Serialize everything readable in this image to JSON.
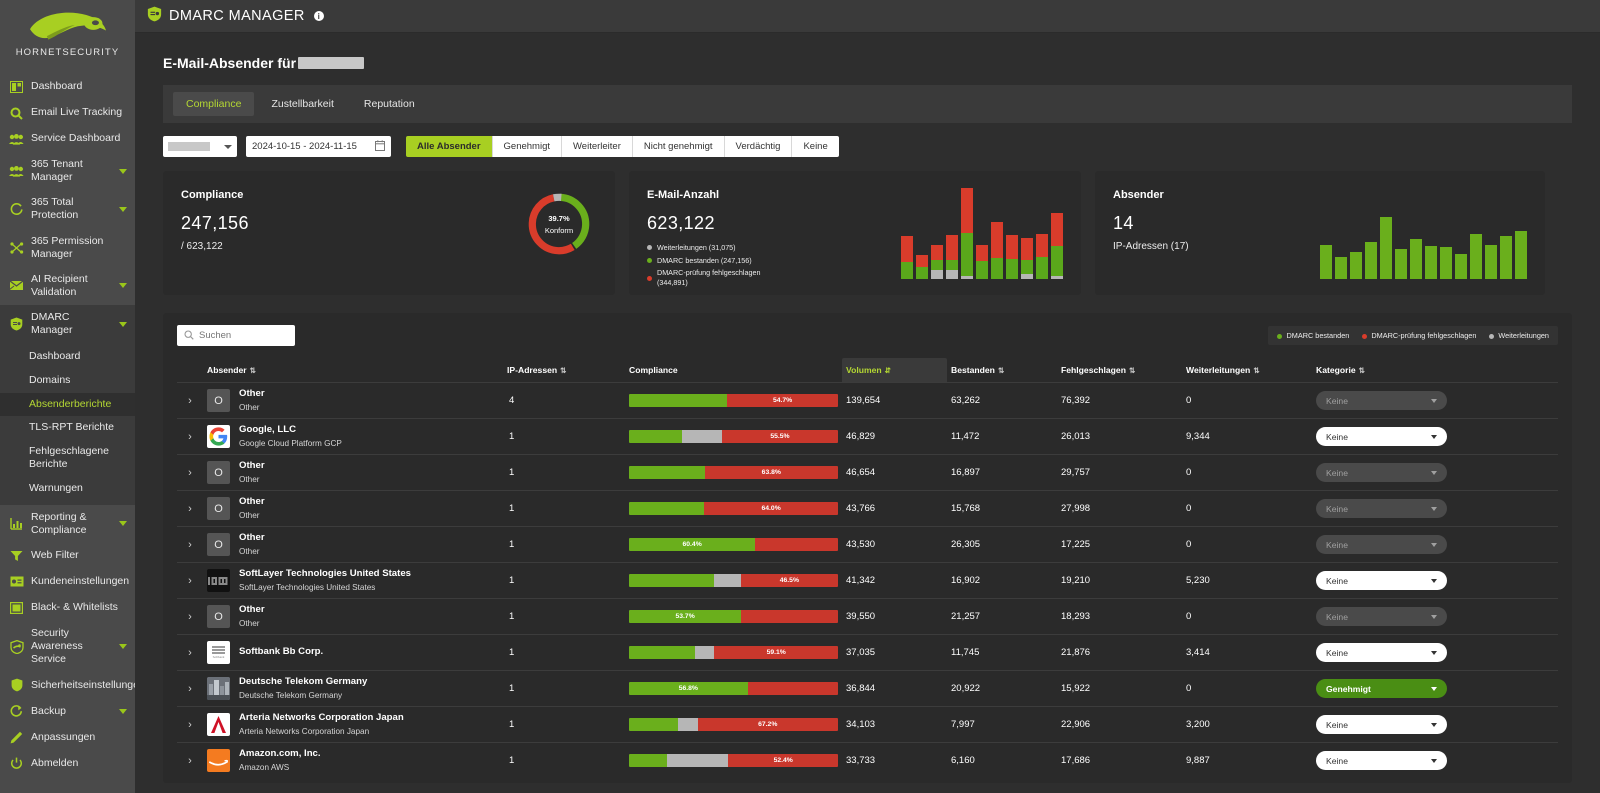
{
  "sidebar": {
    "brand": "HORNETSECURITY",
    "items": [
      {
        "label": "Dashboard",
        "icon": "dashboard-icon",
        "caret": false
      },
      {
        "label": "Email Live Tracking",
        "icon": "search-icon",
        "caret": false
      },
      {
        "label": "Service Dashboard",
        "icon": "people-icon",
        "caret": false
      },
      {
        "label": "365 Tenant Manager",
        "icon": "people-icon",
        "caret": true
      },
      {
        "label": "365 Total Protection",
        "icon": "circle-icon",
        "caret": true
      },
      {
        "label": "365 Permission Manager",
        "icon": "nodes-icon",
        "caret": false
      },
      {
        "label": "AI Recipient Validation",
        "icon": "envelope-check-icon",
        "caret": true
      },
      {
        "label": "DMARC Manager",
        "icon": "shield-icon",
        "caret": true,
        "active": true
      },
      {
        "label": "Reporting & Compliance",
        "icon": "chart-icon",
        "caret": true
      },
      {
        "label": "Web Filter",
        "icon": "filter-icon",
        "caret": false
      },
      {
        "label": "Kundeneinstellungen",
        "icon": "card-icon",
        "caret": true
      },
      {
        "label": "Black- & Whitelists",
        "icon": "list-icon",
        "caret": false
      },
      {
        "label": "Security Awareness Service",
        "icon": "shield-user-icon",
        "caret": true
      },
      {
        "label": "Sicherheitseinstellungen",
        "icon": "shield-lock-icon",
        "caret": true
      },
      {
        "label": "Backup",
        "icon": "refresh-icon",
        "caret": true
      },
      {
        "label": "Anpassungen",
        "icon": "pencil-icon",
        "caret": false
      },
      {
        "label": "Abmelden",
        "icon": "power-icon",
        "caret": false
      }
    ],
    "subnav": [
      {
        "label": "Dashboard",
        "selected": false
      },
      {
        "label": "Domains",
        "selected": false
      },
      {
        "label": "Absenderberichte",
        "selected": true
      },
      {
        "label": "TLS-RPT Berichte",
        "selected": false
      },
      {
        "label": "Fehlgeschlagene Berichte",
        "selected": false
      },
      {
        "label": "Warnungen",
        "selected": false
      }
    ]
  },
  "topbar": {
    "title": "DMARC MANAGER",
    "info": "i"
  },
  "page": {
    "title_prefix": "E-Mail-Absender für"
  },
  "tabs": [
    {
      "label": "Compliance",
      "active": true
    },
    {
      "label": "Zustellbarkeit",
      "active": false
    },
    {
      "label": "Reputation",
      "active": false
    }
  ],
  "filters": {
    "date_range": "2024-10-15 - 2024-11-15",
    "buttons": [
      {
        "label": "Alle Absender",
        "active": true
      },
      {
        "label": "Genehmigt",
        "active": false
      },
      {
        "label": "Weiterleiter",
        "active": false
      },
      {
        "label": "Nicht genehmigt",
        "active": false
      },
      {
        "label": "Verdächtig",
        "active": false
      },
      {
        "label": "Keine",
        "active": false
      }
    ]
  },
  "cards": {
    "compliance": {
      "title": "Compliance",
      "value": "247,156",
      "sub": "/ 623,122",
      "donut_pct": "39.7%",
      "donut_label": "Konform"
    },
    "email_count": {
      "title": "E-Mail-Anzahl",
      "value": "623,122",
      "legend": [
        {
          "label": "Weiterleitungen (31,075)",
          "color": "#b6b6b6"
        },
        {
          "label": "DMARC bestanden (247,156)",
          "color": "#6aaf1c"
        },
        {
          "label": "DMARC-prüfung fehlgeschlagen (344,891)",
          "color": "#d93c2b"
        }
      ]
    },
    "senders": {
      "title": "Absender",
      "value": "14",
      "sub": "IP-Adressen (17)"
    }
  },
  "chart_data": [
    {
      "type": "bar",
      "title": "E-Mail-Anzahl",
      "stacked": true,
      "series": [
        {
          "name": "Weiterleitungen",
          "color": "#b6b6b6",
          "values": [
            0,
            0,
            9,
            9,
            2,
            0,
            0,
            0,
            4,
            0,
            2
          ]
        },
        {
          "name": "DMARC bestanden",
          "color": "#6aaf1c",
          "values": [
            17,
            12,
            10,
            10,
            55,
            18,
            21,
            20,
            17,
            22,
            33
          ]
        },
        {
          "name": "DMARC-prüfung fehlgeschlagen",
          "color": "#d93c2b",
          "values": [
            26,
            12,
            15,
            25,
            45,
            16,
            36,
            24,
            22,
            23,
            33
          ]
        }
      ],
      "ylim": [
        0,
        100
      ],
      "grid": false,
      "legend_position": "left"
    },
    {
      "type": "bar",
      "title": "Absender",
      "color": "#6aaf1c",
      "values": [
        42,
        28,
        33,
        46,
        76,
        37,
        49,
        41,
        39,
        31,
        55,
        42,
        52,
        58
      ],
      "ylim": [
        0,
        80
      ],
      "grid": false
    },
    {
      "type": "pie",
      "title": "Compliance",
      "labels": [
        "DMARC bestanden",
        "DMARC-prüfung fehlgeschlagen",
        "Weiterleitungen"
      ],
      "values": [
        39.7,
        55.3,
        5.0
      ],
      "colors": [
        "#6aaf1c",
        "#d93c2b",
        "#b6b6b6"
      ],
      "center_label": "39.7% Konform"
    }
  ],
  "table": {
    "search_placeholder": "Suchen",
    "legend": [
      {
        "label": "DMARC bestanden",
        "color": "#6aaf1c"
      },
      {
        "label": "DMARC-prüfung fehlgeschlagen",
        "color": "#d93c2b"
      },
      {
        "label": "Weiterleitungen",
        "color": "#b6b6b6"
      }
    ],
    "columns": [
      {
        "label": "Absender",
        "sorted": false
      },
      {
        "label": "IP-Adressen",
        "sorted": false
      },
      {
        "label": "Compliance",
        "sortable": false
      },
      {
        "label": "Volumen",
        "sorted": true
      },
      {
        "label": "Bestanden",
        "sorted": false
      },
      {
        "label": "Fehlgeschlagen",
        "sorted": false
      },
      {
        "label": "Weiterleitungen",
        "sorted": false
      },
      {
        "label": "Kategorie",
        "sorted": false
      }
    ],
    "rows": [
      {
        "name": "Other",
        "desc": "Other",
        "logo": "other-o",
        "ips": "4",
        "green": 47.0,
        "grey": 0,
        "red": 53.0,
        "pct": "54.7%",
        "volume": "139,654",
        "passed": "63,262",
        "failed": "76,392",
        "forwards": "0",
        "category": "Keine",
        "cat_style": "keine-dim"
      },
      {
        "name": "Google, LLC",
        "desc": "Google Cloud Platform GCP",
        "logo": "google",
        "ips": "1",
        "green": 25.5,
        "grey": 19.0,
        "red": 55.5,
        "pct": "55.5%",
        "volume": "46,829",
        "passed": "11,472",
        "failed": "26,013",
        "forwards": "9,344",
        "category": "Keine",
        "cat_style": "keine-white"
      },
      {
        "name": "Other",
        "desc": "Other",
        "logo": "other-o",
        "ips": "1",
        "green": 36.2,
        "grey": 0,
        "red": 63.8,
        "pct": "63.8%",
        "volume": "46,654",
        "passed": "16,897",
        "failed": "29,757",
        "forwards": "0",
        "category": "Keine",
        "cat_style": "keine-dim"
      },
      {
        "name": "Other",
        "desc": "Other",
        "logo": "other-o",
        "ips": "1",
        "green": 36.0,
        "grey": 0,
        "red": 64.0,
        "pct": "64.0%",
        "volume": "43,766",
        "passed": "15,768",
        "failed": "27,998",
        "forwards": "0",
        "category": "Keine",
        "cat_style": "keine-dim"
      },
      {
        "name": "Other",
        "desc": "Other",
        "logo": "other-o",
        "ips": "1",
        "green": 60.4,
        "grey": 0,
        "red": 39.6,
        "pct": "60.4%",
        "pct_on": "green",
        "volume": "43,530",
        "passed": "26,305",
        "failed": "17,225",
        "forwards": "0",
        "category": "Keine",
        "cat_style": "keine-dim"
      },
      {
        "name": "SoftLayer Technologies United States",
        "desc": "SoftLayer Technologies United States",
        "logo": "ibm",
        "ips": "1",
        "green": 40.9,
        "grey": 12.6,
        "red": 46.5,
        "pct": "46.5%",
        "volume": "41,342",
        "passed": "16,902",
        "failed": "19,210",
        "forwards": "5,230",
        "category": "Keine",
        "cat_style": "keine-white"
      },
      {
        "name": "Other",
        "desc": "Other",
        "logo": "other-o",
        "ips": "1",
        "green": 53.7,
        "grey": 0,
        "red": 46.3,
        "pct": "53.7%",
        "pct_on": "green",
        "volume": "39,550",
        "passed": "21,257",
        "failed": "18,293",
        "forwards": "0",
        "category": "Keine",
        "cat_style": "keine-dim"
      },
      {
        "name": "Softbank Bb Corp.",
        "desc": "",
        "logo": "softbank",
        "ips": "1",
        "green": 31.7,
        "grey": 9.2,
        "red": 59.1,
        "pct": "59.1%",
        "volume": "37,035",
        "passed": "11,745",
        "failed": "21,876",
        "forwards": "3,414",
        "category": "Keine",
        "cat_style": "keine-white"
      },
      {
        "name": "Deutsche Telekom Germany",
        "desc": "Deutsche Telekom Germany",
        "logo": "telekom",
        "ips": "1",
        "green": 56.8,
        "grey": 0,
        "red": 43.2,
        "pct": "56.8%",
        "pct_on": "green",
        "volume": "36,844",
        "passed": "20,922",
        "failed": "15,922",
        "forwards": "0",
        "category": "Genehmigt",
        "cat_style": "genehmigt"
      },
      {
        "name": "Arteria Networks Corporation Japan",
        "desc": "Arteria Networks Corporation Japan",
        "logo": "arteria",
        "ips": "1",
        "green": 23.5,
        "grey": 9.3,
        "red": 67.2,
        "pct": "67.2%",
        "volume": "34,103",
        "passed": "7,997",
        "failed": "22,906",
        "forwards": "3,200",
        "category": "Keine",
        "cat_style": "keine-white"
      },
      {
        "name": "Amazon.com, Inc.",
        "desc": "Amazon AWS",
        "logo": "amazon",
        "ips": "1",
        "green": 18.3,
        "grey": 29.3,
        "red": 52.4,
        "pct": "52.4%",
        "volume": "33,733",
        "passed": "6,160",
        "failed": "17,686",
        "forwards": "9,887",
        "category": "Keine",
        "cat_style": "keine-white"
      }
    ]
  },
  "colors": {
    "accent": "#a8cf22",
    "green": "#6aaf1c",
    "red": "#d93c2b",
    "grey": "#b6b6b6",
    "sidebar_bg": "#4a4a4a",
    "panel_bg": "#2a2a2a"
  }
}
